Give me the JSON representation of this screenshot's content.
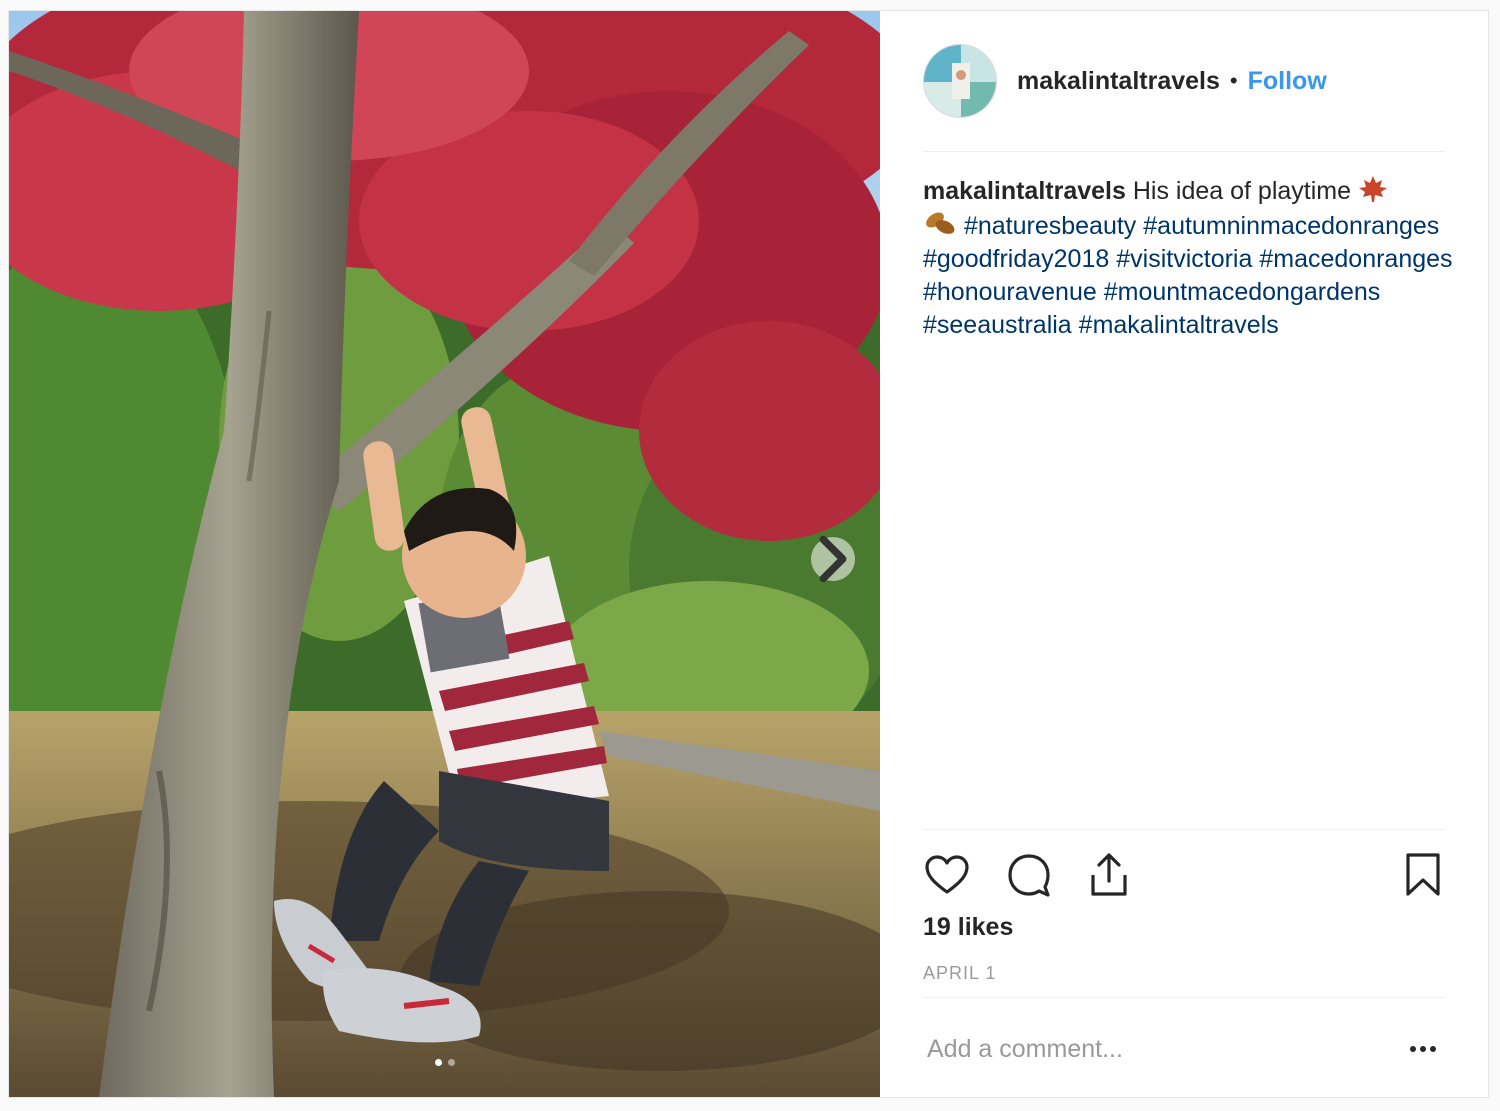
{
  "post": {
    "username": "makalintaltravels",
    "separator": "•",
    "follow_label": "Follow",
    "caption": {
      "username": "makalintaltravels",
      "text": "His idea of playtime",
      "emojis": [
        "maple-leaf-emoji",
        "fallen-leaf-emoji"
      ],
      "hashtags": [
        "#naturesbeauty",
        "#autumninmacedonranges",
        "#goodfriday2018",
        "#visitvictoria",
        "#macedonranges",
        "#honouravenue",
        "#mountmacedongardens",
        "#seeaustralia",
        "#makalintaltravels"
      ]
    },
    "likes": "19 likes",
    "date": "APRIL 1",
    "comment_placeholder": "Add a comment...",
    "carousel": {
      "total": 2,
      "active": 1
    },
    "icons": [
      "heart-icon",
      "comment-icon",
      "share-icon",
      "bookmark-icon",
      "more-options-icon",
      "chevron-right-icon"
    ],
    "colors": {
      "link": "#3897f0",
      "hashtag": "#003569",
      "muted": "#999999",
      "text": "#262626"
    }
  }
}
